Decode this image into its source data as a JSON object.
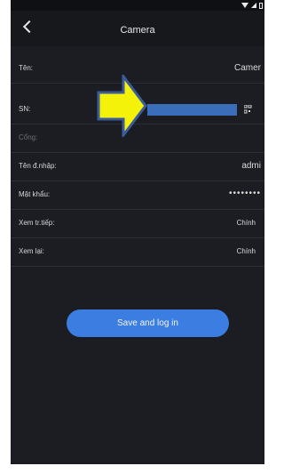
{
  "screen": {
    "title": "Camera"
  },
  "fields": [
    {
      "id": "name",
      "label": "Tên:",
      "value": "Camer"
    },
    {
      "id": "sn",
      "label": "SN:",
      "value": ""
    },
    {
      "id": "port",
      "label": "Cổng:",
      "value": ""
    },
    {
      "id": "username",
      "label": "Tên đ.nhập:",
      "value": "admi"
    },
    {
      "id": "password",
      "label": "Mật khẩu:",
      "value": "••••••••"
    },
    {
      "id": "live_view",
      "label": "Xem tr.tiếp:",
      "value": "Chính"
    },
    {
      "id": "playback",
      "label": "Xem lại:",
      "value": "Chính"
    }
  ],
  "actions": {
    "save_label": "Save and log in"
  },
  "colors": {
    "background": "#1b1d22",
    "accent_button": "#3b7de0",
    "arrow_fill": "#f5f20a",
    "arrow_outline": "#3b5c99"
  },
  "icons": {
    "back": "chevron-left-icon",
    "qr": "qr-scan-icon",
    "pointer": "arrow-right-icon"
  }
}
